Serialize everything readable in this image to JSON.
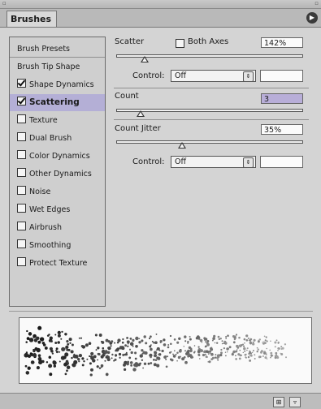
{
  "panel": {
    "tab_label": "Brushes",
    "menu_icon": "right-arrow-icon"
  },
  "sidebar": {
    "items": [
      {
        "label": "Brush Presets",
        "checkbox": false,
        "selected": false
      },
      {
        "label": "Brush Tip Shape",
        "checkbox": false,
        "selected": false
      },
      {
        "label": "Shape Dynamics",
        "checkbox": true,
        "checked": true,
        "selected": false
      },
      {
        "label": "Scattering",
        "checkbox": true,
        "checked": true,
        "selected": true
      },
      {
        "label": "Texture",
        "checkbox": true,
        "checked": false,
        "selected": false
      },
      {
        "label": "Dual Brush",
        "checkbox": true,
        "checked": false,
        "selected": false
      },
      {
        "label": "Color Dynamics",
        "checkbox": true,
        "checked": false,
        "selected": false
      },
      {
        "label": "Other Dynamics",
        "checkbox": true,
        "checked": false,
        "selected": false
      },
      {
        "label": "Noise",
        "checkbox": true,
        "checked": false,
        "selected": false
      },
      {
        "label": "Wet Edges",
        "checkbox": true,
        "checked": false,
        "selected": false
      },
      {
        "label": "Airbrush",
        "checkbox": true,
        "checked": false,
        "selected": false
      },
      {
        "label": "Smoothing",
        "checkbox": true,
        "checked": false,
        "selected": false
      },
      {
        "label": "Protect Texture",
        "checkbox": true,
        "checked": false,
        "selected": false
      }
    ]
  },
  "scatter": {
    "label": "Scatter",
    "both_axes_label": "Both Axes",
    "both_axes_checked": false,
    "value": "142%",
    "slider_level": 0.15,
    "control_label": "Control:",
    "control_value": "Off"
  },
  "count": {
    "label": "Count",
    "value": "3",
    "slider_level": 0.13
  },
  "count_jitter": {
    "label": "Count Jitter",
    "value": "35%",
    "slider_level": 0.35,
    "control_label": "Control:",
    "control_value": "Off"
  },
  "footer": {
    "buttons": [
      "new-brush-icon",
      "trash-icon"
    ]
  },
  "colors": {
    "selection": "#b4afd6",
    "highlight_field": "#b8aed8",
    "panel_bg": "#d4d4d4"
  }
}
